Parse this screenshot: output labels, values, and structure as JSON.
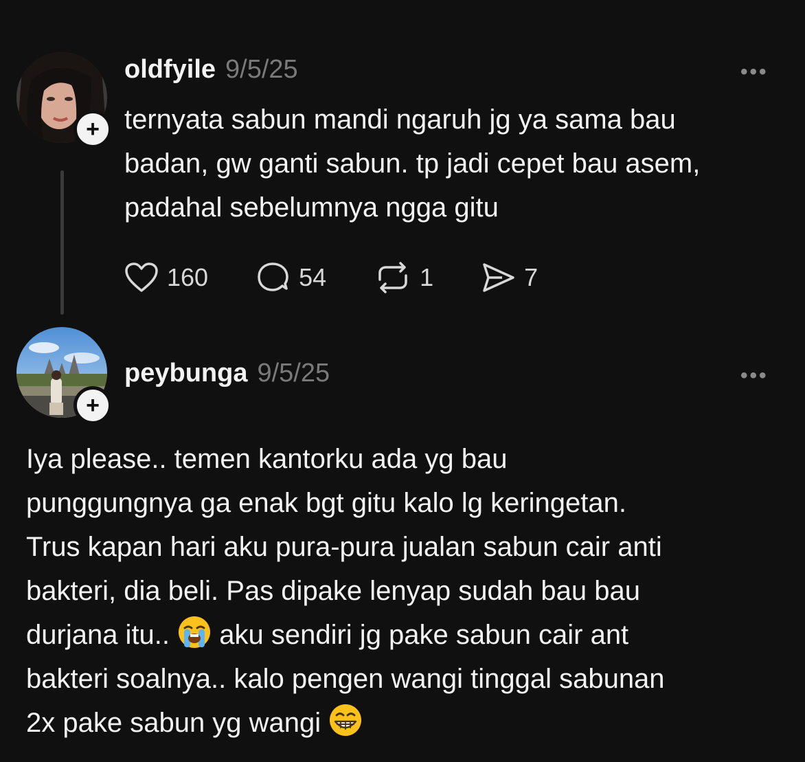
{
  "posts": [
    {
      "username": "oldfyile",
      "date": "9/5/25",
      "more_label": "•••",
      "follow_label": "+",
      "lines": [
        "ternyata sabun mandi ngaruh jg ya sama bau",
        "badan, gw ganti sabun. tp jadi cepet bau asem,",
        "padahal sebelumnya ngga gitu"
      ],
      "stats": {
        "likes": "160",
        "replies": "54",
        "reposts": "1",
        "shares": "7"
      }
    },
    {
      "username": "peybunga",
      "date": "9/5/25",
      "more_label": "•••",
      "follow_label": "+",
      "lines": [
        "Iya please.. temen kantorku ada yg bau",
        "punggungnya ga enak bgt gitu kalo lg keringetan.",
        "Trus kapan hari aku pura-pura jualan sabun cair anti",
        "bakteri, dia beli. Pas dipake lenyap sudah bau bau"
      ],
      "line5_before": "durjana itu.. ",
      "line5_after": " aku sendiri jg pake sabun cair ant",
      "line6": "bakteri soalnya.. kalo pengen wangi tinggal sabunan",
      "line7": "2x pake sabun yg wangi ",
      "emojis": [
        "loudly-crying-face-emoji",
        "grinning-face-emoji"
      ]
    }
  ],
  "colors": {
    "background": "#101010",
    "text": "#f3f3f3",
    "muted": "#7a7a7a",
    "thread_line": "#3a3a3a"
  }
}
